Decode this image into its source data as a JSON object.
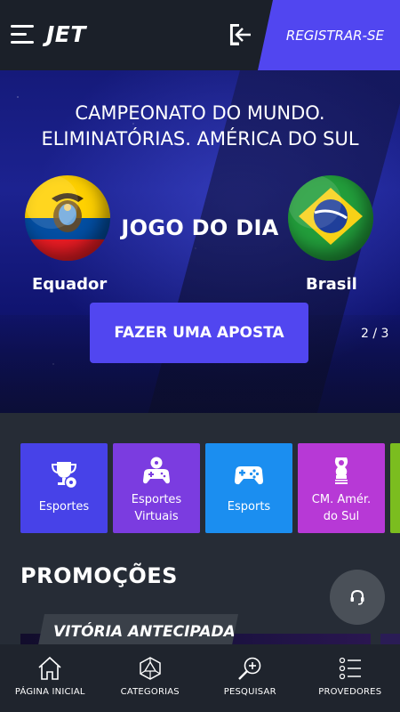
{
  "header": {
    "logo": "JET",
    "register_label": "REGISTRAR-SE"
  },
  "banner": {
    "title_line1": "CAMPEONATO DO MUNDO.",
    "title_line2": "ELIMINATÓRIAS. AMÉRICA DO SUL",
    "headline": "JOGO DO DIA",
    "team_home": "Equador",
    "team_away": "Brasil",
    "cta_label": "FAZER UMA APOSTA",
    "pager": "2 / 3"
  },
  "categories": [
    {
      "label": "Esportes",
      "color": "#4742e8",
      "icon": "trophy-ball-icon"
    },
    {
      "label": "Esportes Virtuais",
      "color": "#7b3ce0",
      "icon": "gamepad-ball-icon"
    },
    {
      "label": "Esports",
      "color": "#1b8ef0",
      "icon": "controller-icon"
    },
    {
      "label": "CM. Amér. do Sul",
      "color": "#b739d6",
      "icon": "world-cup-icon"
    },
    {
      "label": "",
      "color": "#7bbd1f",
      "icon": ""
    }
  ],
  "promotions": {
    "title": "PROMOÇÕES",
    "tag": "VITÓRIA ANTECIPADA"
  },
  "bottom_nav": [
    {
      "label": "PÁGINA INICIAL",
      "icon": "home-icon"
    },
    {
      "label": "CATEGORIAS",
      "icon": "categories-icon"
    },
    {
      "label": "PESQUISAR",
      "icon": "search-icon"
    },
    {
      "label": "PROVEDORES",
      "icon": "providers-icon"
    }
  ],
  "colors": {
    "accent": "#5146f0",
    "background": "#262c36",
    "header": "#1b2029"
  }
}
